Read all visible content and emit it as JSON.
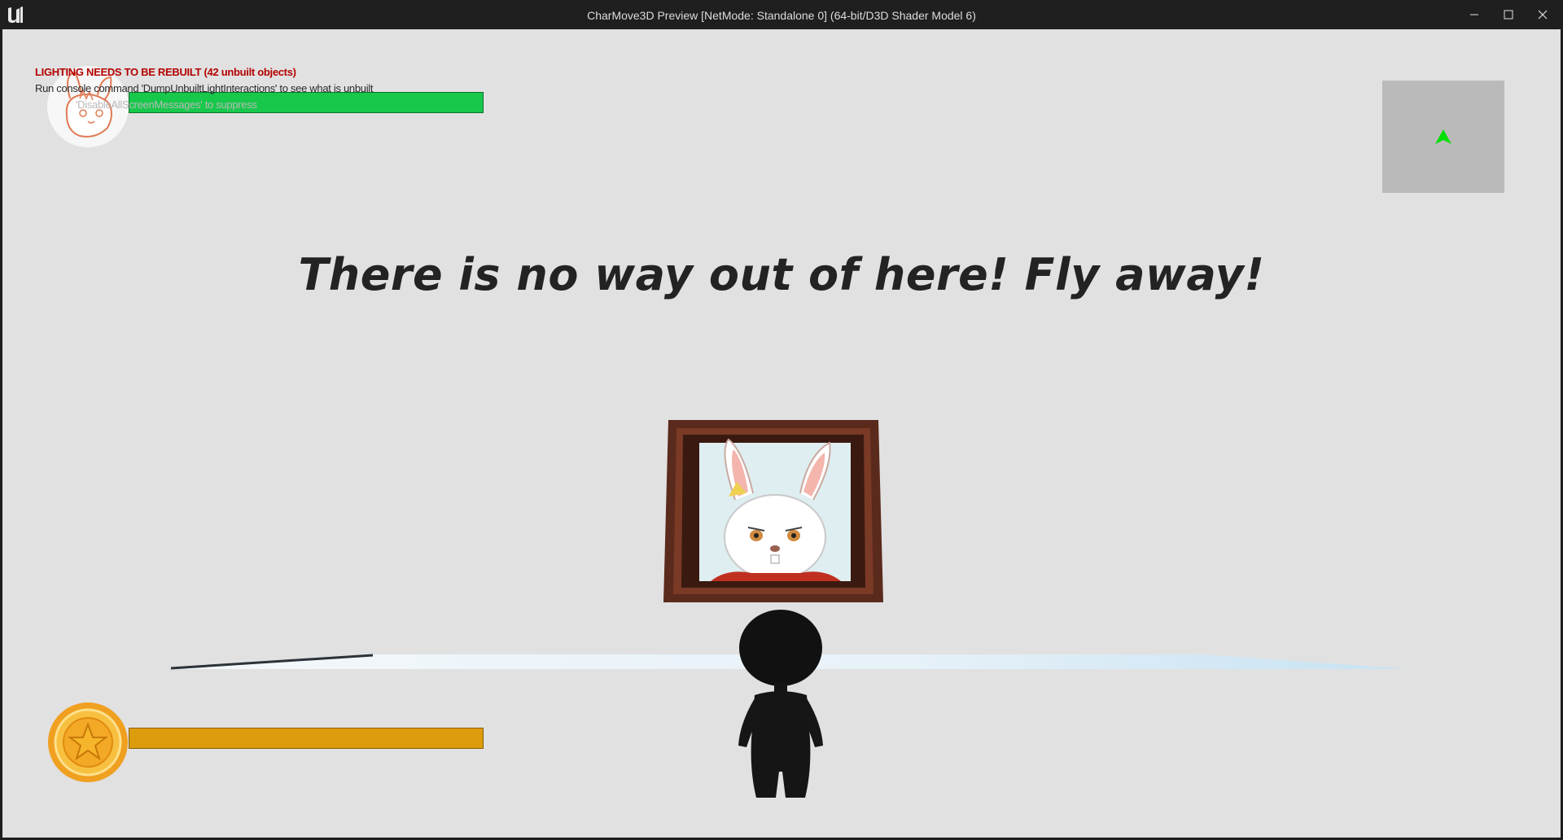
{
  "window": {
    "title": "CharMove3D Preview [NetMode: Standalone 0]  (64-bit/D3D Shader Model 6)",
    "logo_icon": "unreal-engine-logo",
    "controls": [
      "minimize-icon",
      "maximize-icon",
      "close-icon"
    ]
  },
  "debug_messages": {
    "line1": "LIGHTING NEEDS TO BE REBUILT (42 unbuilt objects)",
    "line2": "Run console command 'DumpUnbuiltLightInteractions' to see what is unbuilt",
    "line3": "'DisableAllScreenMessages' to suppress",
    "line1_color": "#b30000"
  },
  "hud": {
    "health_bar": {
      "icon": "bunny-avatar-icon",
      "color": "#17c84b",
      "fill_fraction": 1.0
    },
    "coin_bar": {
      "icon": "star-coin-icon",
      "color": "#dd9c0b",
      "fill_fraction": 1.0
    },
    "minimap": {
      "player_marker": "green-arrow-icon",
      "marker_color": "#00e000"
    }
  },
  "world": {
    "message": "There is no way out of here! Fly away!",
    "picture": "framed-bunny-portrait",
    "player": "black-mannequin-character"
  }
}
